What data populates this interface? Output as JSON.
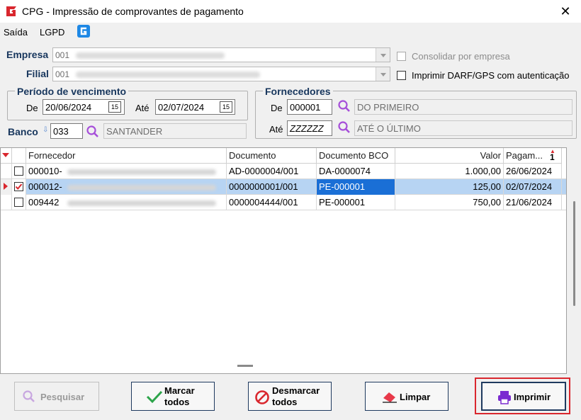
{
  "window": {
    "title": "CPG - Impressão de comprovantes de pagamento"
  },
  "menu": {
    "items": [
      "Saída",
      "LGPD"
    ]
  },
  "empresa": {
    "label": "Empresa",
    "value": "001"
  },
  "filial": {
    "label": "Filial",
    "value": "001"
  },
  "options": {
    "consolidar": "Consolidar por empresa",
    "imprimir_darf": "Imprimir DARF/GPS com autenticação"
  },
  "periodo": {
    "title": "Período de vencimento",
    "de_label": "De",
    "de_value": "20/06/2024",
    "ate_label": "Até",
    "ate_value": "02/07/2024"
  },
  "fornecedores": {
    "title": "Fornecedores",
    "de_label": "De",
    "de_value": "000001",
    "de_name": "DO PRIMEIRO",
    "ate_label": "Até",
    "ate_value": "ZZZZZZ",
    "ate_name": "ATÉ O ÚLTIMO"
  },
  "banco": {
    "label": "Banco",
    "code": "033",
    "name": "SANTANDER"
  },
  "grid": {
    "columns": [
      "Fornecedor",
      "Documento",
      "Documento BCO",
      "Valor",
      "Pagam..."
    ],
    "sort_indicator": "1",
    "rows": [
      {
        "checked": false,
        "fornecedor": "000010-",
        "documento": "AD-0000004/001",
        "doc_bco": "DA-0000074",
        "valor": "1.000,00",
        "pagamento": "26/06/2024"
      },
      {
        "checked": true,
        "fornecedor": "000012-",
        "documento": "0000000001/001",
        "doc_bco": "PE-000001",
        "valor": "125,00",
        "pagamento": "02/07/2024"
      },
      {
        "checked": false,
        "fornecedor": "009442",
        "documento": "0000004444/001",
        "doc_bco": "PE-000001",
        "valor": "750,00",
        "pagamento": "21/06/2024"
      }
    ]
  },
  "buttons": {
    "pesquisar": "Pesquisar",
    "marcar_1": "Marcar",
    "marcar_2": "todos",
    "desmarcar_1": "Desmarcar",
    "desmarcar_2": "todos",
    "limpar": "Limpar",
    "imprimir": "Imprimir"
  },
  "colors": {
    "accent": "#1a6fd6",
    "highlight": "#d9272e",
    "label": "#17365d",
    "search": "#a64fd9"
  }
}
